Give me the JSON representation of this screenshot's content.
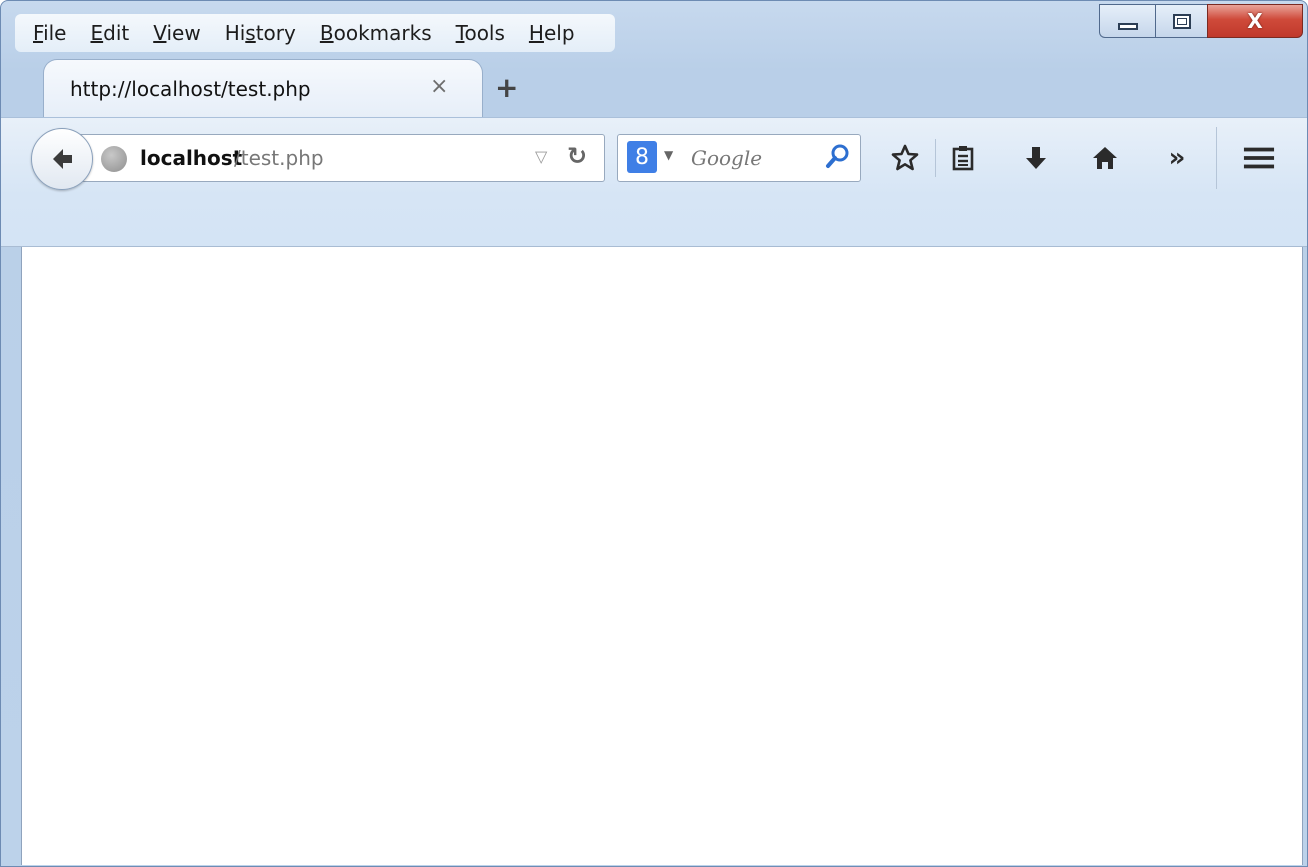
{
  "menubar": {
    "items": [
      {
        "pre": "",
        "acc": "F",
        "post": "ile"
      },
      {
        "pre": "",
        "acc": "E",
        "post": "dit"
      },
      {
        "pre": "",
        "acc": "V",
        "post": "iew"
      },
      {
        "pre": "Hi",
        "acc": "s",
        "post": "tory"
      },
      {
        "pre": "",
        "acc": "B",
        "post": "ookmarks"
      },
      {
        "pre": "",
        "acc": "T",
        "post": "ools"
      },
      {
        "pre": "",
        "acc": "H",
        "post": "elp"
      }
    ]
  },
  "window_controls": {
    "close_glyph": "X"
  },
  "tabs": [
    {
      "title": "http://localhost/test.php",
      "close_glyph": "×"
    }
  ],
  "new_tab_glyph": "+",
  "urlbar": {
    "host": "localhost",
    "path": "/test.php"
  },
  "search": {
    "engine_badge": "8",
    "placeholder": "Google"
  },
  "toolbar": {
    "overflow_glyph": "»"
  },
  "icons": [
    "back-arrow-icon",
    "globe-icon",
    "dropdown-triangle-icon",
    "reload-icon",
    "google-icon",
    "search-icon",
    "bookmark-star-icon",
    "reading-list-icon",
    "download-icon",
    "home-icon",
    "overflow-chevron-icon",
    "hamburger-menu-icon",
    "minimize-icon",
    "maximize-icon",
    "close-icon"
  ]
}
